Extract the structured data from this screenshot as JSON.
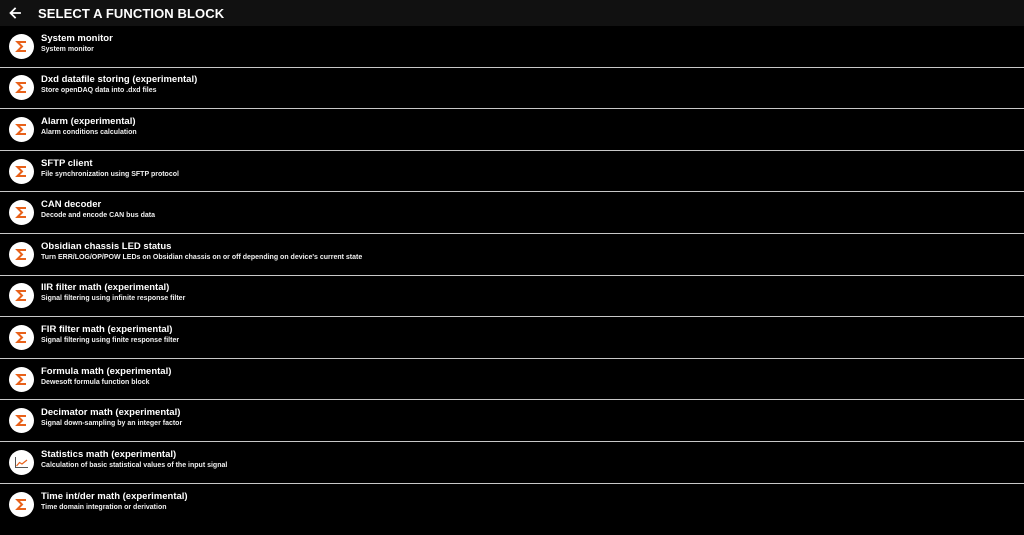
{
  "header": {
    "title": "SELECT A FUNCTION BLOCK",
    "back_icon": "arrow-left-icon"
  },
  "colors": {
    "accent": "#e8611a",
    "background": "#000000",
    "header_bg": "#111111",
    "divider": "#c8c8c8"
  },
  "items": [
    {
      "name": "System monitor",
      "description": "System monitor",
      "icon": "sigma-icon"
    },
    {
      "name": "Dxd datafile storing (experimental)",
      "description": "Store openDAQ data into .dxd files",
      "icon": "sigma-icon"
    },
    {
      "name": "Alarm (experimental)",
      "description": "Alarm conditions calculation",
      "icon": "sigma-icon"
    },
    {
      "name": "SFTP client",
      "description": "File synchronization using SFTP protocol",
      "icon": "sigma-icon"
    },
    {
      "name": "CAN decoder",
      "description": "Decode and encode CAN bus data",
      "icon": "sigma-icon"
    },
    {
      "name": "Obsidian chassis LED status",
      "description": "Turn ERR/LOG/OP/POW LEDs on Obsidian chassis on or off depending on device's current state",
      "icon": "sigma-icon"
    },
    {
      "name": "IIR filter math (experimental)",
      "description": "Signal filtering using infinite response filter",
      "icon": "sigma-icon"
    },
    {
      "name": "FIR filter math (experimental)",
      "description": "Signal filtering using finite response filter",
      "icon": "sigma-icon"
    },
    {
      "name": "Formula math (experimental)",
      "description": "Dewesoft formula function block",
      "icon": "sigma-icon"
    },
    {
      "name": "Decimator math (experimental)",
      "description": "Signal down-sampling by an integer factor",
      "icon": "sigma-icon"
    },
    {
      "name": "Statistics math (experimental)",
      "description": "Calculation of basic statistical values of the input signal",
      "icon": "line-chart-icon"
    },
    {
      "name": "Time int/der math (experimental)",
      "description": "Time domain integration or derivation",
      "icon": "sigma-icon"
    }
  ]
}
